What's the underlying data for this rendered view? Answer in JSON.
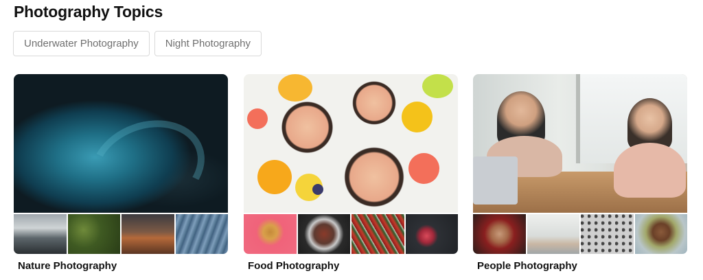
{
  "header": {
    "title": "Photography Topics"
  },
  "chips": [
    {
      "label": "Underwater Photography"
    },
    {
      "label": "Night Photography"
    }
  ],
  "cards": [
    {
      "title": "Nature Photography",
      "hero_alt": "wave-photo",
      "thumbs": [
        "mountain-photo",
        "forest-photo",
        "desert-photo",
        "ice-photo"
      ]
    },
    {
      "title": "Food Photography",
      "hero_alt": "fruit-bowls-photo",
      "thumbs": [
        "burger-fries-photo",
        "dish-photo",
        "skewers-photo",
        "raspberries-photo"
      ]
    },
    {
      "title": "People Photography",
      "hero_alt": "two-women-photo",
      "thumbs": [
        "man-portrait-photo",
        "living-room-photo",
        "crowd-photo",
        "woman-smiling-photo"
      ]
    }
  ],
  "colors": {
    "chip_border": "#d9d9d9",
    "chip_text": "#6f6f6f",
    "title": "#111111"
  }
}
